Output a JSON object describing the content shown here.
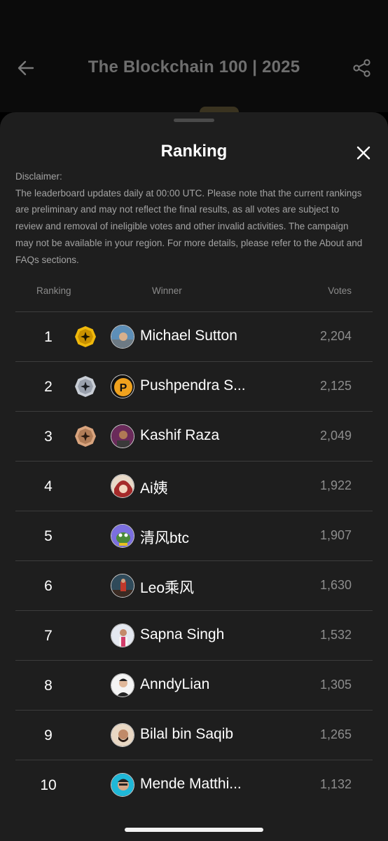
{
  "header": {
    "title": "The Blockchain 100 | 2025",
    "back_icon": "arrow-left-icon",
    "share_icon": "share-icon"
  },
  "sheet": {
    "title": "Ranking",
    "close_icon": "close-icon",
    "disclaimer_label": "Disclaimer:",
    "disclaimer_text": "The leaderboard updates daily at 00:00 UTC. Please note that the current rankings are preliminary and may not reflect the final results, as all votes are subject to review and removal of ineligible votes and other invalid activities. The campaign may not be available in your region. For more details, please refer to the About and FAQs sections."
  },
  "table": {
    "headers": {
      "rank": "Ranking",
      "winner": "Winner",
      "votes": "Votes"
    },
    "rows": [
      {
        "rank": "1",
        "name": "Michael Sutton",
        "votes": "2,204",
        "medal": "gold"
      },
      {
        "rank": "2",
        "name": "Pushpendra S...",
        "votes": "2,125",
        "medal": "silver"
      },
      {
        "rank": "3",
        "name": "Kashif Raza",
        "votes": "2,049",
        "medal": "bronze"
      },
      {
        "rank": "4",
        "name": "Ai姨",
        "votes": "1,922",
        "medal": ""
      },
      {
        "rank": "5",
        "name": "清风btc",
        "votes": "1,907",
        "medal": ""
      },
      {
        "rank": "6",
        "name": "Leo乘风",
        "votes": "1,630",
        "medal": ""
      },
      {
        "rank": "7",
        "name": "Sapna Singh",
        "votes": "1,532",
        "medal": ""
      },
      {
        "rank": "8",
        "name": "AnndyLian",
        "votes": "1,305",
        "medal": ""
      },
      {
        "rank": "9",
        "name": "Bilal bin Saqib",
        "votes": "1,265",
        "medal": ""
      },
      {
        "rank": "10",
        "name": "Mende Matthi...",
        "votes": "1,132",
        "medal": ""
      }
    ]
  },
  "colors": {
    "gold": "#f0b90b",
    "silver": "#c9ced6",
    "bronze": "#d9a47e",
    "sheet_bg": "#1e1e1e"
  }
}
